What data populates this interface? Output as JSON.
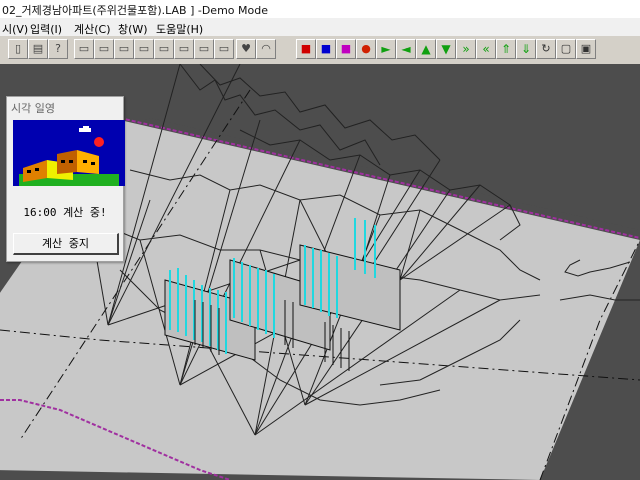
{
  "window": {
    "title": "02_거제경남아파트(주위건물포함).LAB ] -Demo Mode"
  },
  "menu": {
    "items": [
      {
        "label": "시(V)"
      },
      {
        "label": "입력(I)"
      },
      {
        "label": "계산(C)"
      },
      {
        "label": "창(W)"
      },
      {
        "label": "도움말(H)"
      }
    ]
  },
  "toolbar": {
    "buttons": [
      {
        "icon": "new-file-icon",
        "glyph": "▯"
      },
      {
        "icon": "print-preview-icon",
        "glyph": "▤"
      },
      {
        "icon": "help-icon",
        "glyph": "?"
      },
      {
        "icon": "doc-icon-1",
        "glyph": "▭"
      },
      {
        "icon": "doc-icon-2",
        "glyph": "▭"
      },
      {
        "icon": "doc-icon-3",
        "glyph": "▭"
      },
      {
        "icon": "doc-icon-4",
        "glyph": "▭"
      },
      {
        "icon": "doc-icon-5",
        "glyph": "▭"
      },
      {
        "icon": "doc-icon-6",
        "glyph": "▭"
      },
      {
        "icon": "doc-icon-7",
        "glyph": "▭"
      },
      {
        "icon": "doc-icon-8",
        "glyph": "▭"
      },
      {
        "icon": "heart-icon",
        "glyph": "♥"
      },
      {
        "icon": "dome-icon",
        "glyph": "◠"
      },
      {
        "icon": "monitor-red-icon",
        "glyph": "■",
        "color": "#d00000"
      },
      {
        "icon": "monitor-blue-icon",
        "glyph": "■",
        "color": "#0000d0"
      },
      {
        "icon": "monitor-magenta-icon",
        "glyph": "■",
        "color": "#c000c0"
      },
      {
        "icon": "sphere-red-icon",
        "glyph": "●",
        "color": "#d02000"
      },
      {
        "icon": "arrow-right-icon",
        "glyph": "►",
        "color": "#10a010"
      },
      {
        "icon": "arrow-left-icon",
        "glyph": "◄",
        "color": "#10a010"
      },
      {
        "icon": "arrow-up-icon",
        "glyph": "▲",
        "color": "#10a010"
      },
      {
        "icon": "arrow-down-icon",
        "glyph": "▼",
        "color": "#10a010"
      },
      {
        "icon": "double-right-icon",
        "glyph": "»",
        "color": "#10a010"
      },
      {
        "icon": "double-left-icon",
        "glyph": "«",
        "color": "#10a010"
      },
      {
        "icon": "double-up-icon",
        "glyph": "⇑",
        "color": "#10a010"
      },
      {
        "icon": "double-down-icon",
        "glyph": "⇓",
        "color": "#10a010"
      },
      {
        "icon": "rotate-icon",
        "glyph": "↻",
        "color": "#333"
      },
      {
        "icon": "box-icon",
        "glyph": "▢",
        "color": "#333"
      },
      {
        "icon": "box3d-icon",
        "glyph": "▣",
        "color": "#333"
      }
    ]
  },
  "panel": {
    "title": "시각 일영",
    "status": "16:00 계산 중!",
    "stop_button": "계산 중지"
  }
}
